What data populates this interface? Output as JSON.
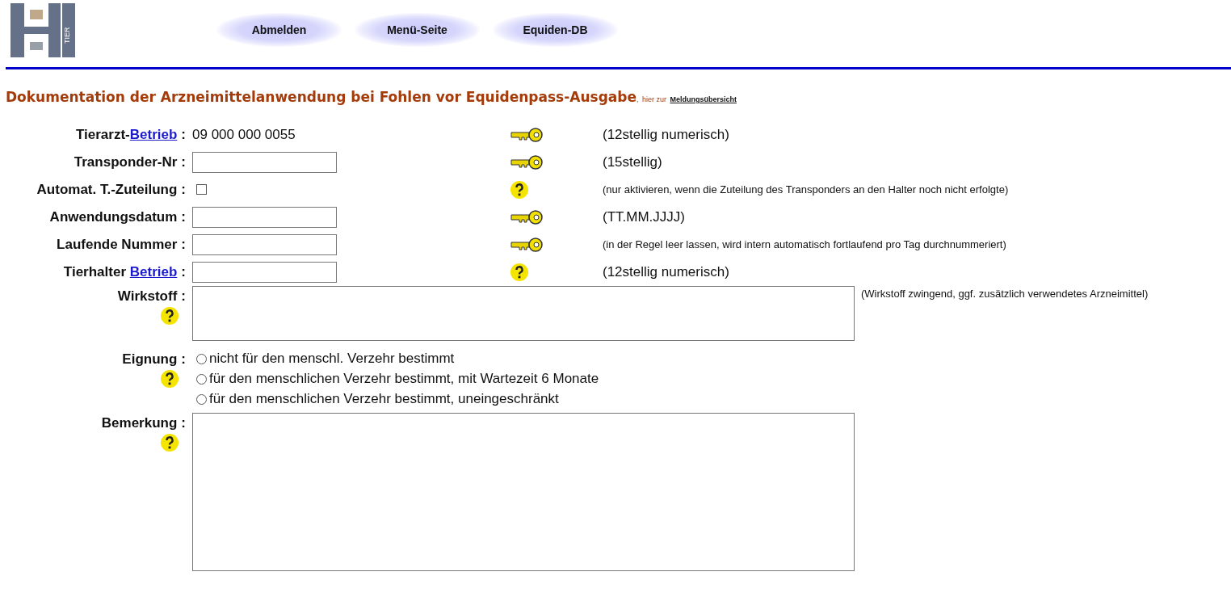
{
  "logo": {
    "text": "TIER"
  },
  "nav": [
    {
      "label": "Abmelden"
    },
    {
      "label": "Menü-Seite"
    },
    {
      "label": "Equiden-DB"
    }
  ],
  "heading": {
    "title": "Dokumentation der Arzneimittelanwendung bei Fohlen vor Equidenpass-Ausgabe",
    "sep": ",",
    "note": "hier zur",
    "link": "Meldungsübersicht"
  },
  "rows": [
    {
      "kind": "text",
      "label": "Tierarzt-",
      "link": "Betrieb",
      "colon": ":",
      "value": "09 000 000 0055",
      "required": true,
      "hint": {
        "kind": "normal",
        "text": "(12stellig numerisch)"
      }
    },
    {
      "kind": "input",
      "label": "Transponder-Nr",
      "colon": ":",
      "required": true,
      "hint": {
        "kind": "normal",
        "text": "(15stellig)"
      }
    },
    {
      "kind": "checkbox",
      "label": "Automat. T.-Zuteilung",
      "colon": ":",
      "checked": false,
      "required": false,
      "hint": {
        "kind": "small",
        "text": "(nur aktivieren, wenn die Zuteilung des Transponders an den Halter noch nicht erfolgte)"
      }
    },
    {
      "kind": "input",
      "label": "Anwendungsdatum",
      "colon": ":",
      "required": true,
      "hint": {
        "kind": "normal",
        "text": "(TT.MM.JJJJ)"
      }
    },
    {
      "kind": "input",
      "label": "Laufende Nummer",
      "colon": ":",
      "required": true,
      "hint": {
        "kind": "small",
        "text": "(in der Regel leer lassen, wird intern automatisch fortlaufend pro Tag durchnummeriert)"
      }
    },
    {
      "kind": "input",
      "label": "Tierhalter ",
      "link": "Betrieb",
      "colon": ":",
      "required": false,
      "hint": {
        "kind": "normal",
        "text": "(12stellig numerisch)"
      }
    },
    {
      "kind": "textarea-short",
      "label": "Wirkstoff",
      "colon": ":",
      "hint": {
        "kind": "small",
        "text": "(Wirkstoff zwingend, ggf. zusätzlich verwendetes Arzneimittel)"
      }
    },
    {
      "kind": "radio",
      "label": "Eignung",
      "colon": ":",
      "options": [
        {
          "label": "nicht für den menschl. Verzehr bestimmt",
          "selected": false
        },
        {
          "label": "für den menschlichen Verzehr bestimmt, mit Wartezeit 6 Monate",
          "selected": false
        },
        {
          "label": "für den menschlichen Verzehr bestimmt, uneingeschränkt",
          "selected": false
        }
      ]
    },
    {
      "kind": "textarea-tall",
      "label": "Bemerkung",
      "colon": ":"
    }
  ]
}
